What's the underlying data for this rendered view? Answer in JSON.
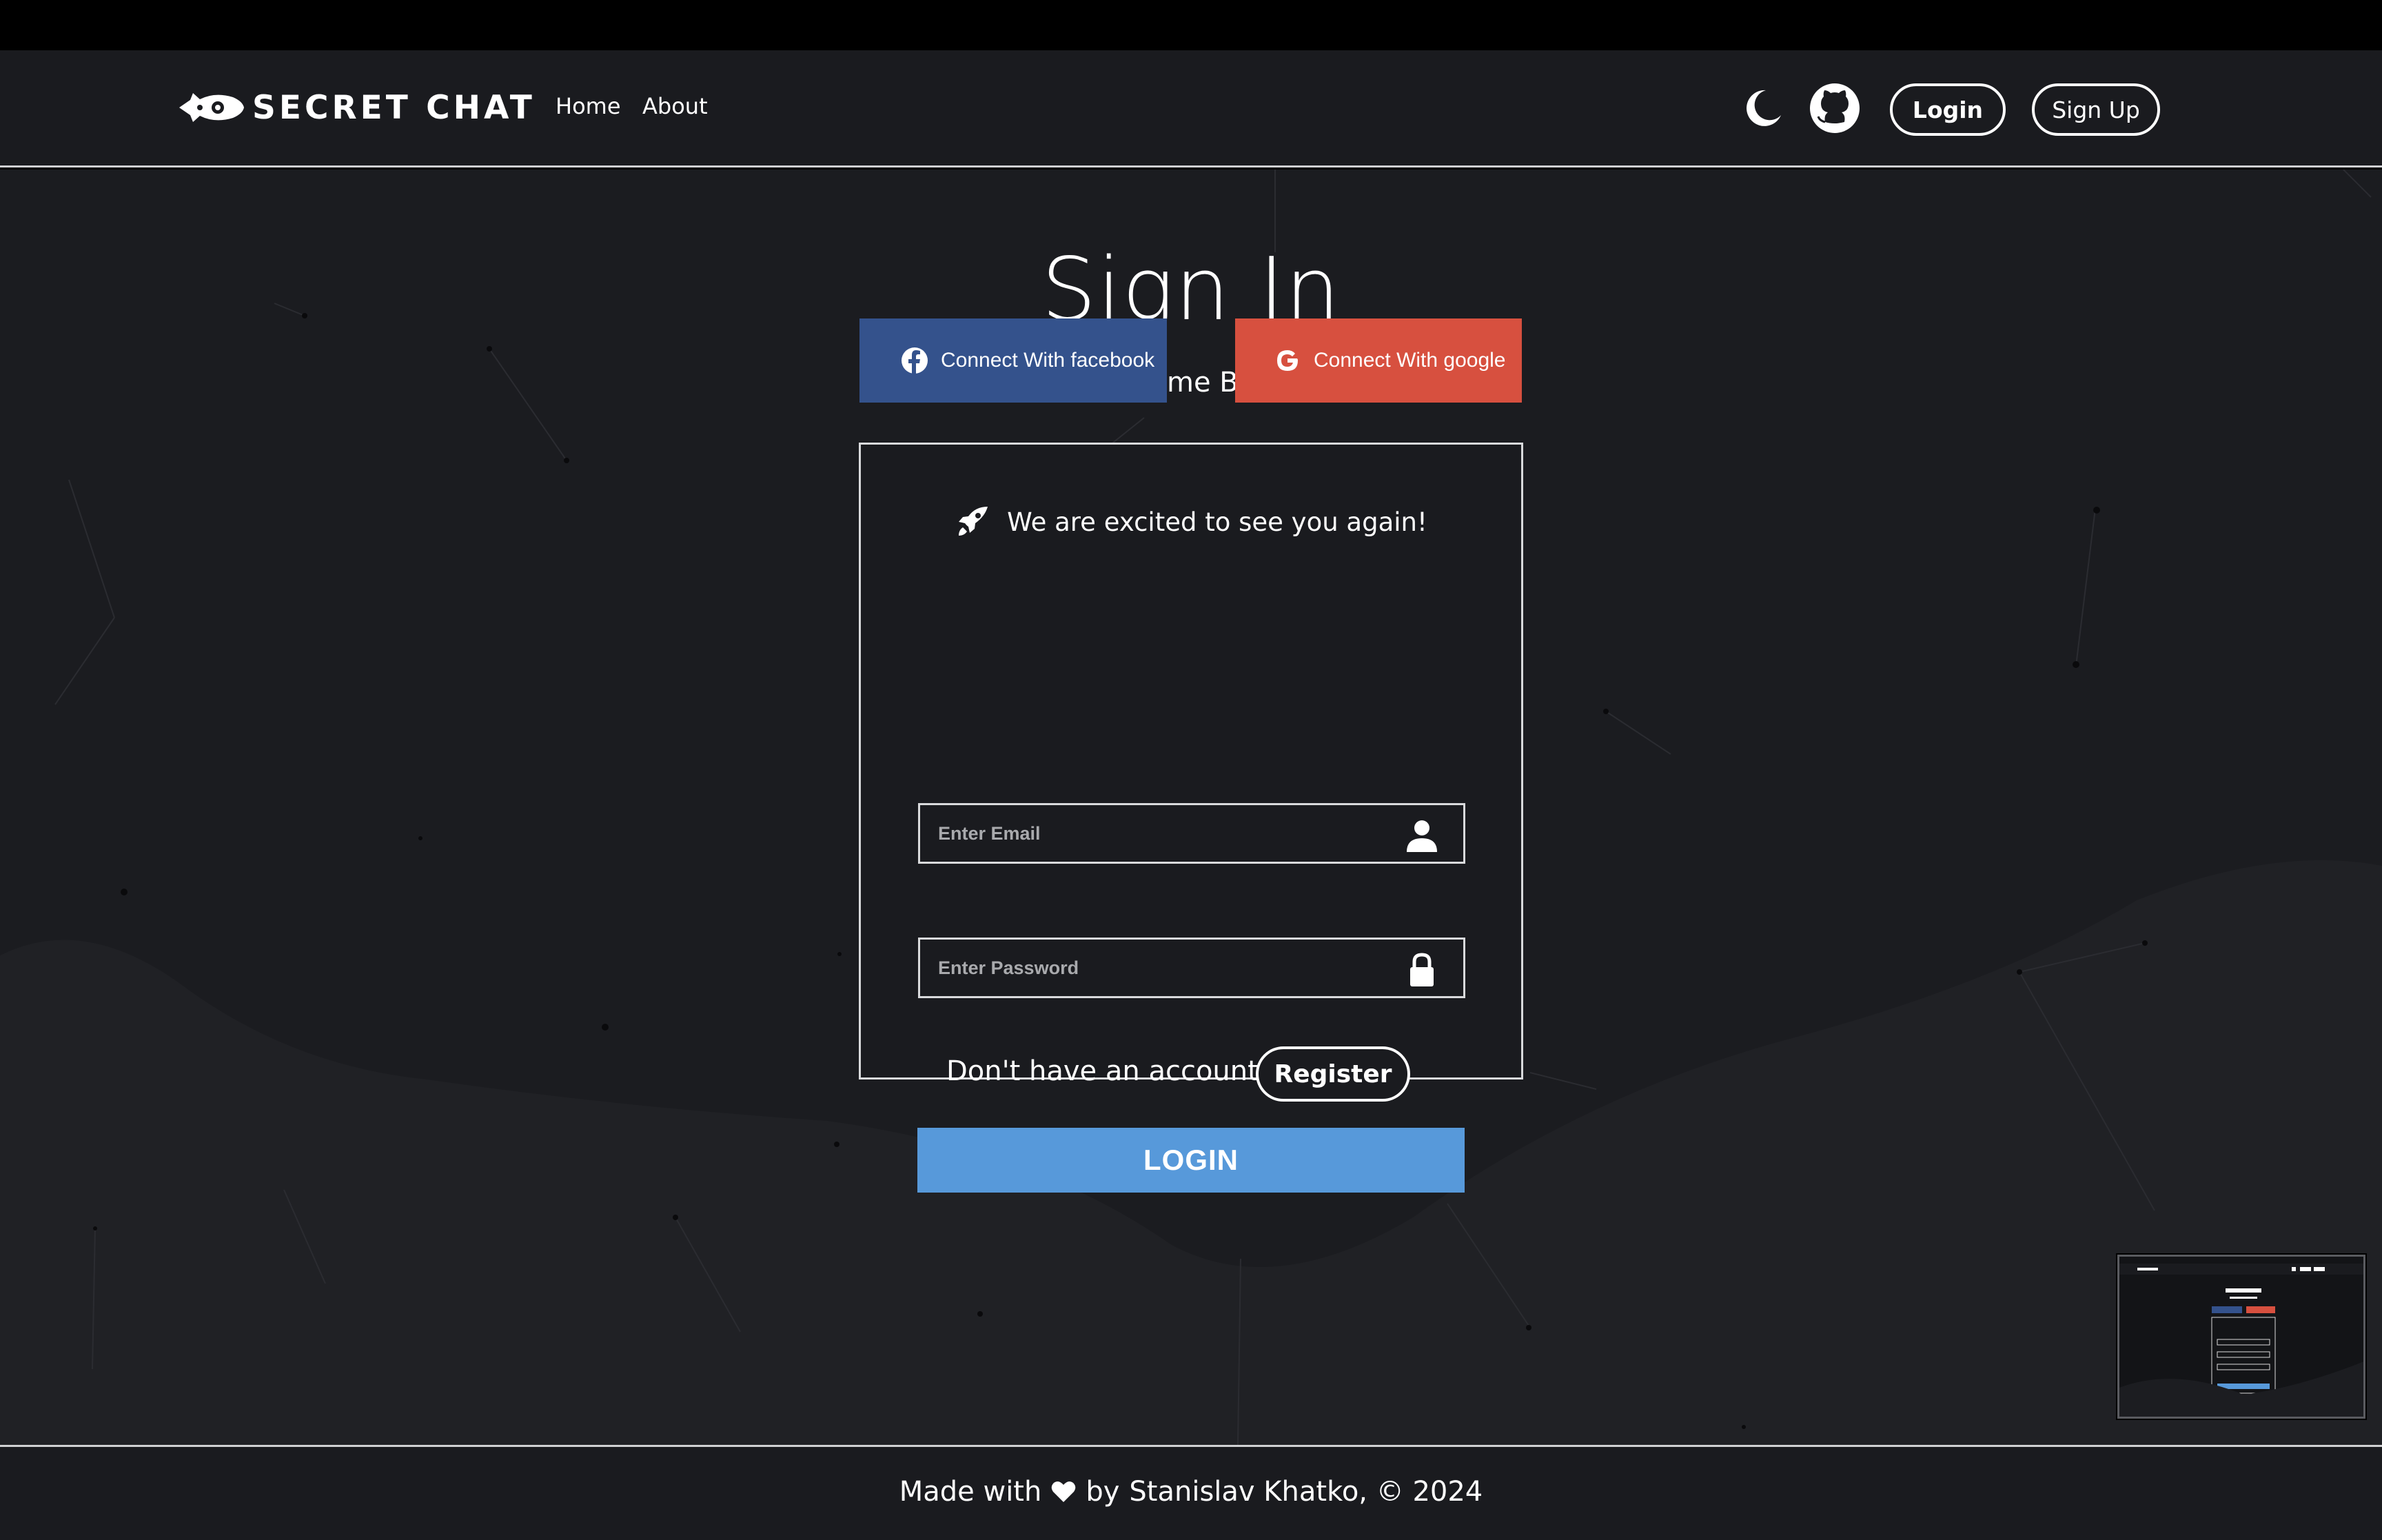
{
  "brand": {
    "name": "SECRET CHAT"
  },
  "nav": {
    "links": [
      {
        "label": "Home"
      },
      {
        "label": "About"
      }
    ],
    "icons": {
      "theme": "moon-icon",
      "repo": "github-icon"
    },
    "login_label": "Login",
    "signup_label": "Sign Up"
  },
  "page": {
    "title": "Sign In",
    "subtitle": "Welcome Back!"
  },
  "social": {
    "facebook_label": "Connect With facebook",
    "google_label": "Connect With google",
    "facebook_color": "#34528c",
    "google_color": "#d7503f"
  },
  "form": {
    "heading": "We are excited to see you again!",
    "email_placeholder": "Enter Email",
    "password_placeholder": "Enter Password",
    "no_account_text": "Don't have an account?",
    "register_label": "Register",
    "login_label": "LOGIN",
    "login_color": "#5799da"
  },
  "footer": {
    "made_with": "Made with",
    "by": "by",
    "author": "Stanislav Khatko, © 2024"
  }
}
